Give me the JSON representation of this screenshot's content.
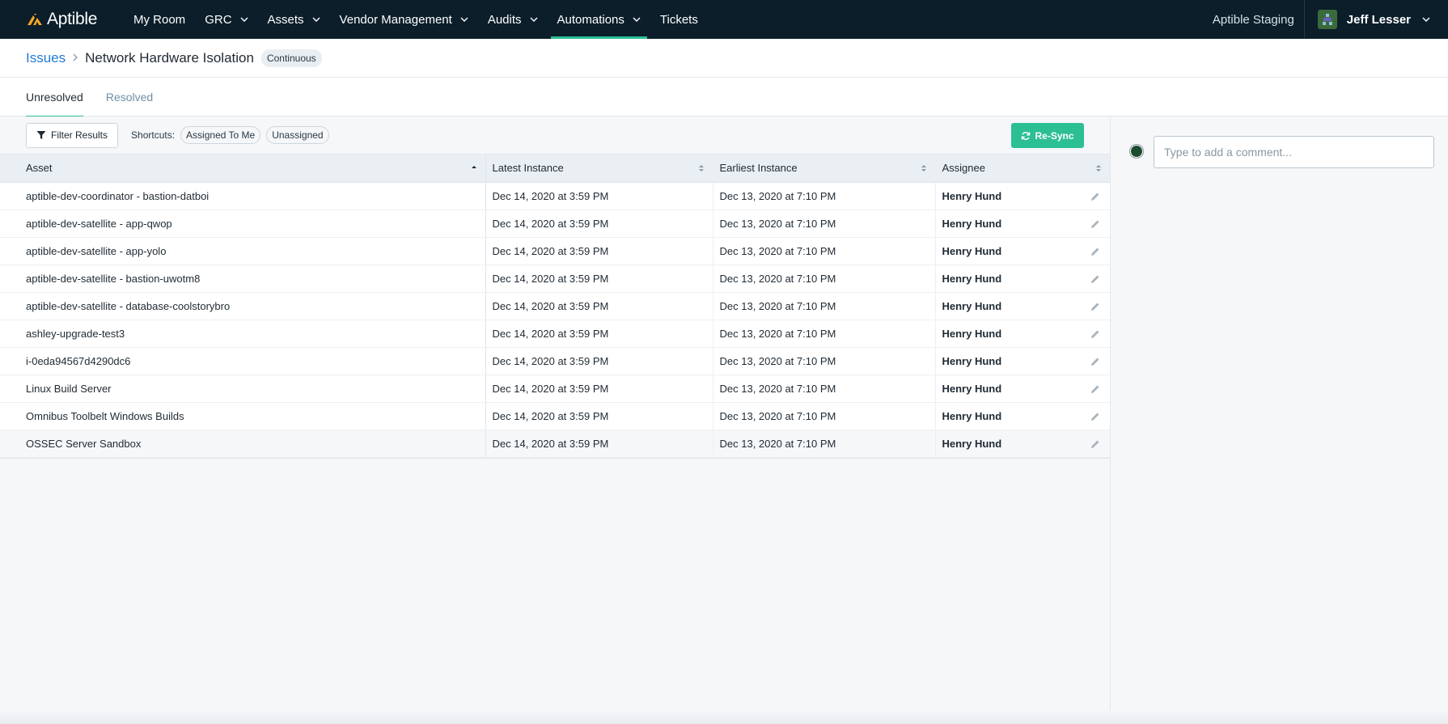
{
  "app": {
    "name": "Aptible"
  },
  "nav": {
    "items": [
      {
        "label": "My Room",
        "has_menu": false,
        "active": false
      },
      {
        "label": "GRC",
        "has_menu": true,
        "active": false
      },
      {
        "label": "Assets",
        "has_menu": true,
        "active": false
      },
      {
        "label": "Vendor Management",
        "has_menu": true,
        "active": false
      },
      {
        "label": "Audits",
        "has_menu": true,
        "active": false
      },
      {
        "label": "Automations",
        "has_menu": true,
        "active": true
      },
      {
        "label": "Tickets",
        "has_menu": false,
        "active": false
      }
    ],
    "org": "Aptible Staging",
    "user": "Jeff Lesser"
  },
  "breadcrumb": {
    "parent": "Issues",
    "title": "Network Hardware Isolation",
    "badge": "Continuous"
  },
  "tabs": [
    {
      "label": "Unresolved",
      "active": true
    },
    {
      "label": "Resolved",
      "active": false
    }
  ],
  "toolbar": {
    "filter_label": "Filter Results",
    "shortcuts_label": "Shortcuts:",
    "shortcuts": [
      "Assigned To Me",
      "Unassigned"
    ],
    "resync_label": "Re-Sync"
  },
  "table": {
    "columns": [
      "Asset",
      "Latest Instance",
      "Earliest Instance",
      "Assignee"
    ],
    "sorted_column": "Asset",
    "rows": [
      {
        "asset": "aptible-dev-coordinator - bastion-datboi",
        "latest": "Dec 14, 2020 at 3:59 PM",
        "earliest": "Dec 13, 2020 at 7:10 PM",
        "assignee": "Henry Hund"
      },
      {
        "asset": "aptible-dev-satellite - app-qwop",
        "latest": "Dec 14, 2020 at 3:59 PM",
        "earliest": "Dec 13, 2020 at 7:10 PM",
        "assignee": "Henry Hund"
      },
      {
        "asset": "aptible-dev-satellite - app-yolo",
        "latest": "Dec 14, 2020 at 3:59 PM",
        "earliest": "Dec 13, 2020 at 7:10 PM",
        "assignee": "Henry Hund"
      },
      {
        "asset": "aptible-dev-satellite - bastion-uwotm8",
        "latest": "Dec 14, 2020 at 3:59 PM",
        "earliest": "Dec 13, 2020 at 7:10 PM",
        "assignee": "Henry Hund"
      },
      {
        "asset": "aptible-dev-satellite - database-coolstorybro",
        "latest": "Dec 14, 2020 at 3:59 PM",
        "earliest": "Dec 13, 2020 at 7:10 PM",
        "assignee": "Henry Hund"
      },
      {
        "asset": "ashley-upgrade-test3",
        "latest": "Dec 14, 2020 at 3:59 PM",
        "earliest": "Dec 13, 2020 at 7:10 PM",
        "assignee": "Henry Hund"
      },
      {
        "asset": "i-0eda94567d4290dc6",
        "latest": "Dec 14, 2020 at 3:59 PM",
        "earliest": "Dec 13, 2020 at 7:10 PM",
        "assignee": "Henry Hund"
      },
      {
        "asset": "Linux Build Server",
        "latest": "Dec 14, 2020 at 3:59 PM",
        "earliest": "Dec 13, 2020 at 7:10 PM",
        "assignee": "Henry Hund"
      },
      {
        "asset": "Omnibus Toolbelt Windows Builds",
        "latest": "Dec 14, 2020 at 3:59 PM",
        "earliest": "Dec 13, 2020 at 7:10 PM",
        "assignee": "Henry Hund"
      },
      {
        "asset": "OSSEC Server Sandbox",
        "latest": "Dec 14, 2020 at 3:59 PM",
        "earliest": "Dec 13, 2020 at 7:10 PM",
        "assignee": "Henry Hund"
      }
    ]
  },
  "comments": {
    "placeholder": "Type to add a comment..."
  },
  "icons": {
    "logo": "aptible-logo-icon",
    "filter": "filter-icon",
    "resync": "refresh-icon",
    "edit": "pencil-icon",
    "sort": "sort-icon",
    "chevron": "chevron-down-icon"
  },
  "colors": {
    "nav_bg": "#0b1e2a",
    "accent": "#2dbf94",
    "link": "#1f7bd6",
    "logo": "#f5a623"
  }
}
